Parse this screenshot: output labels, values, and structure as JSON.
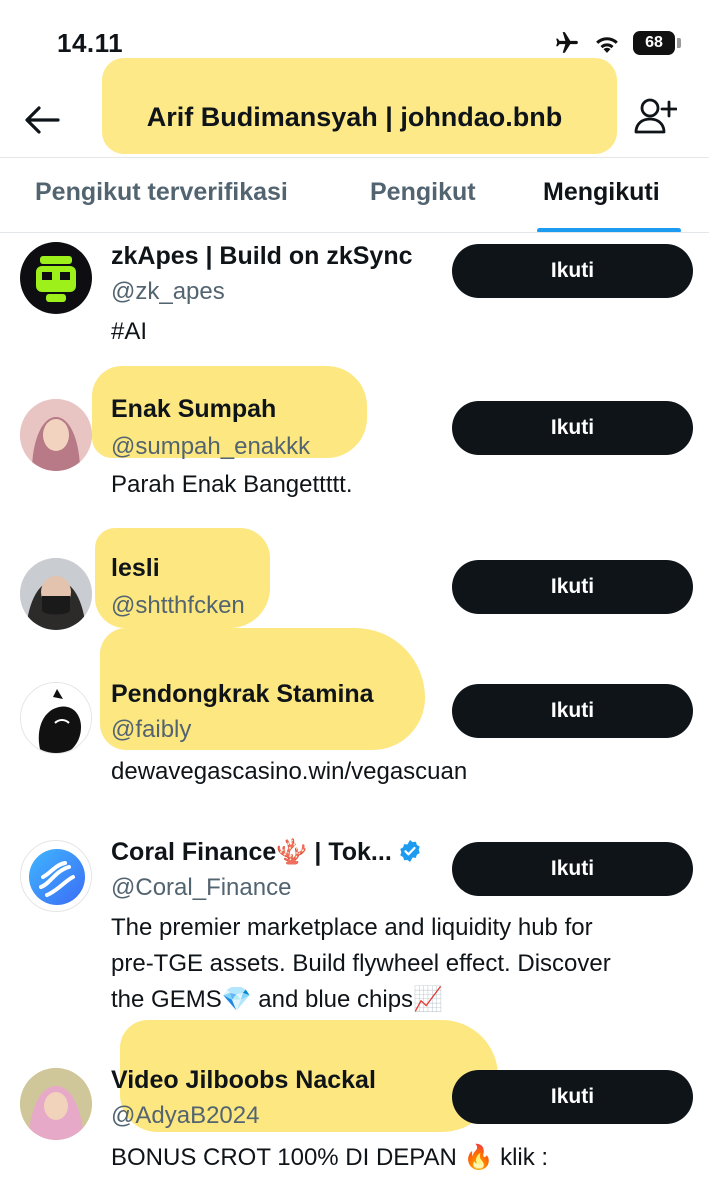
{
  "status_bar": {
    "time": "14.11",
    "battery": "68"
  },
  "header": {
    "title": "Arif Budimansyah | johndao.bnb"
  },
  "tabs": [
    {
      "label": "Pengikut terverifikasi"
    },
    {
      "label": "Pengikut"
    },
    {
      "label": "Mengikuti"
    }
  ],
  "users": [
    {
      "name": "zkApes | Build on zkSync",
      "handle": "@zk_apes",
      "bio": "#AI",
      "button": "Ikuti"
    },
    {
      "name": "Enak Sumpah",
      "handle": "@sumpah_enakkk",
      "bio": "Parah Enak Bangettttt.",
      "button": "Ikuti"
    },
    {
      "name": "lesli",
      "handle": "@shtthfcken",
      "bio": "",
      "button": "Ikuti"
    },
    {
      "name": "Pendongkrak Stamina",
      "handle": "@faibly",
      "bio": "dewavegascasino.win/vegascuan",
      "button": "Ikuti"
    },
    {
      "name": "Coral Finance🪸 | Tok...",
      "handle": "@Coral_Finance",
      "bio_lines": [
        "The premier marketplace and liquidity hub for",
        "pre-TGE assets. Build flywheel effect. Discover",
        "the GEMS💎 and blue chips📈"
      ],
      "button": "Ikuti",
      "verified": true
    },
    {
      "name": "Video Jilboobs Nackal",
      "handle": "@AdyaB2024",
      "bio": "BONUS CROT 100% DI DEPAN 🔥 klik :",
      "button": "Ikuti"
    }
  ],
  "colors": {
    "accent": "#1d9bf0",
    "button_bg": "#0f1419",
    "highlight": "#fde36a",
    "secondary_text": "#536471"
  }
}
